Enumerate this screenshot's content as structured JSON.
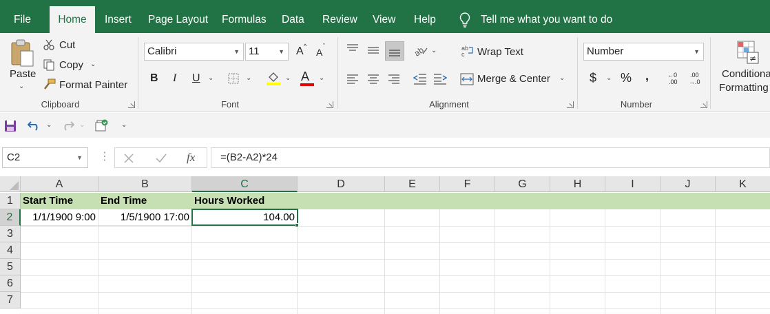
{
  "menu": {
    "file": "File",
    "home": "Home",
    "insert": "Insert",
    "page_layout": "Page Layout",
    "formulas": "Formulas",
    "data": "Data",
    "review": "Review",
    "view": "View",
    "help": "Help",
    "tell_me": "Tell me what you want to do"
  },
  "ribbon": {
    "clipboard": {
      "paste": "Paste",
      "cut": "Cut",
      "copy": "Copy",
      "format_painter": "Format Painter",
      "label": "Clipboard"
    },
    "font": {
      "name": "Calibri",
      "size": "11",
      "bold": "B",
      "italic": "I",
      "underline": "U",
      "font_color_glyph": "A",
      "grow": "A",
      "shrink": "A",
      "label": "Font"
    },
    "alignment": {
      "wrap_text": "Wrap Text",
      "merge_center": "Merge & Center",
      "label": "Alignment"
    },
    "number": {
      "format": "Number",
      "currency": "$",
      "percent": "%",
      "comma": ",",
      "increase_decimal_top": "←0",
      "increase_decimal_bottom": ".00",
      "decrease_decimal_top": ".00",
      "decrease_decimal_bottom": "→.0",
      "label": "Number"
    },
    "styles": {
      "conditional_line1": "Conditional",
      "conditional_line2": "Formatting"
    }
  },
  "formula_bar": {
    "name_box": "C2",
    "formula": "=(B2-A2)*24",
    "fx": "fx"
  },
  "sheet": {
    "columns": [
      "A",
      "B",
      "C",
      "D",
      "E",
      "F",
      "G",
      "H",
      "I",
      "J",
      "K"
    ],
    "rows": [
      "1",
      "2",
      "3",
      "4",
      "5",
      "6",
      "7"
    ],
    "cells": {
      "A1": "Start Time",
      "B1": "End Time",
      "C1": "Hours Worked",
      "A2": "1/1/1900 9:00",
      "B2": "1/5/1900 17:00",
      "C2": "104.00"
    }
  },
  "colors": {
    "brand": "#217346",
    "header_fill": "#c6e0b4",
    "ribbon_bg": "#f3f3f3"
  }
}
